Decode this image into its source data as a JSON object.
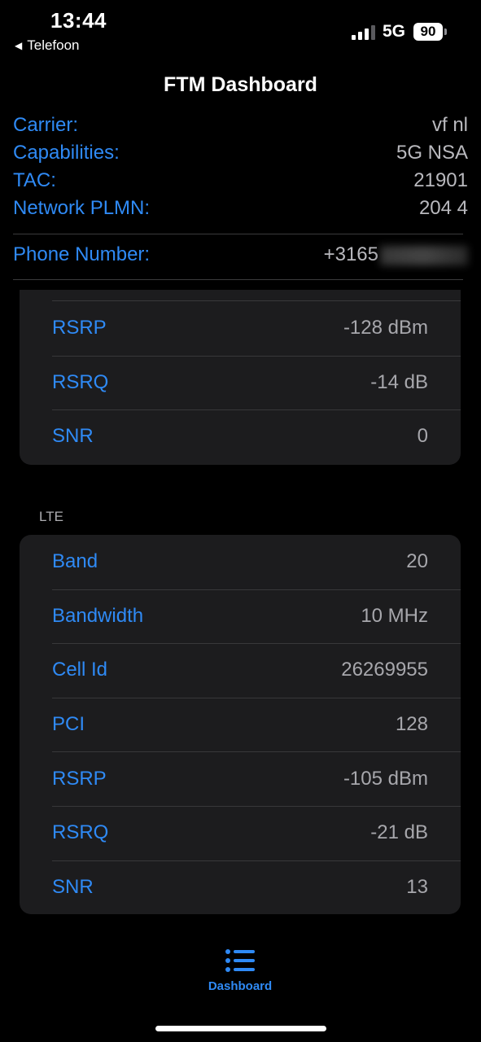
{
  "status_bar": {
    "time": "13:44",
    "back_label": "Telefoon",
    "network": "5G",
    "battery": "90"
  },
  "nav": {
    "title": "FTM Dashboard"
  },
  "info": [
    {
      "label": "Carrier:",
      "value": "vf nl"
    },
    {
      "label": "Capabilities:",
      "value": "5G NSA"
    },
    {
      "label": "TAC:",
      "value": "21901"
    },
    {
      "label": "Network PLMN:",
      "value": "204 4"
    }
  ],
  "phone": {
    "label": "Phone Number:",
    "value": "+3165"
  },
  "nr_card": [
    {
      "label": "RSRP",
      "value": "-128 dBm"
    },
    {
      "label": "RSRQ",
      "value": "-14 dB"
    },
    {
      "label": "SNR",
      "value": "0"
    }
  ],
  "lte": {
    "header": "LTE",
    "rows": [
      {
        "label": "Band",
        "value": "20"
      },
      {
        "label": "Bandwidth",
        "value": "10 MHz"
      },
      {
        "label": "Cell Id",
        "value": "26269955"
      },
      {
        "label": "PCI",
        "value": "128"
      },
      {
        "label": "RSRP",
        "value": "-105 dBm"
      },
      {
        "label": "RSRQ",
        "value": "-21 dB"
      },
      {
        "label": "SNR",
        "value": "13"
      }
    ]
  },
  "tabbar": {
    "label": "Dashboard",
    "icon": "list-icon"
  },
  "colors": {
    "accent": "#2f8af5",
    "background": "#000000",
    "card": "#1c1c1e"
  }
}
